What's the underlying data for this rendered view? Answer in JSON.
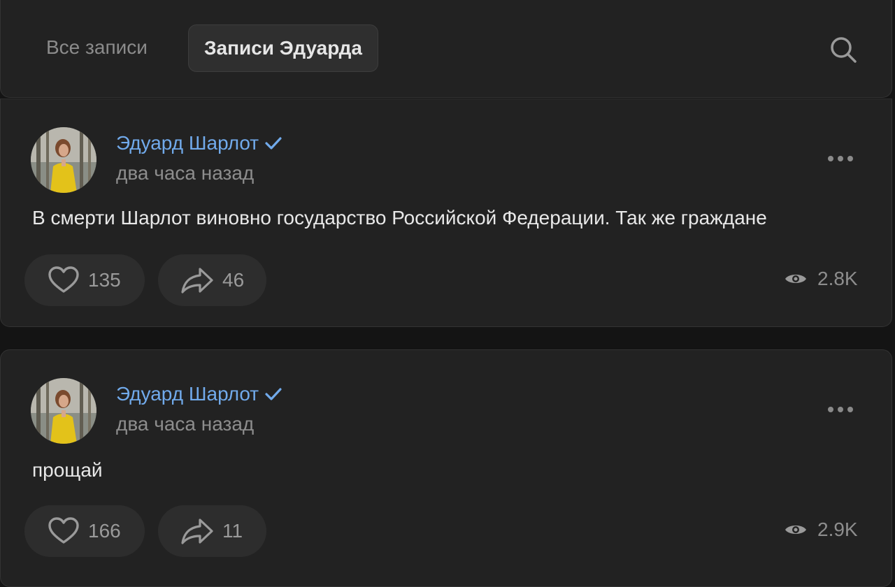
{
  "header": {
    "tabs": [
      {
        "label": "Все записи",
        "active": false
      },
      {
        "label": "Записи Эдуарда",
        "active": true
      }
    ],
    "search_icon": "search-icon"
  },
  "posts": [
    {
      "author": "Эдуард Шарлот",
      "verified": true,
      "time": "два часа назад",
      "text": "В смерти Шарлот виновно государство Российской Федерации. Так же граждане",
      "likes": "135",
      "shares": "46",
      "views": "2.8K"
    },
    {
      "author": "Эдуард Шарлот",
      "verified": true,
      "time": "два часа назад",
      "text": "прощай",
      "likes": "166",
      "shares": "11",
      "views": "2.9K"
    }
  ],
  "colors": {
    "background": "#141414",
    "card": "#222222",
    "author_link": "#71aaeb",
    "muted_text": "#8d8d8d"
  }
}
